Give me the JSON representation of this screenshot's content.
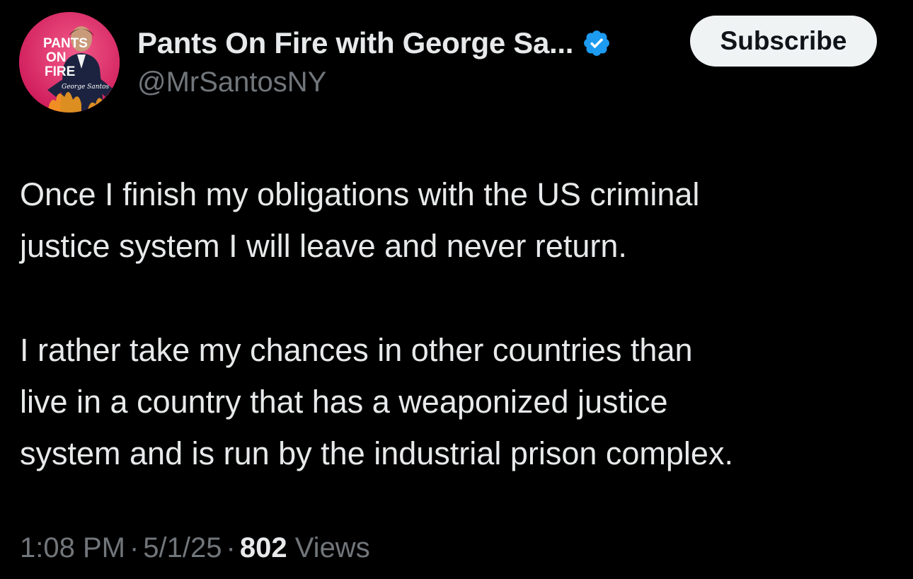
{
  "author": {
    "display_name": "Pants On Fire with George Sa...",
    "handle": "@MrSantosNY",
    "verified_icon": "verified-badge-icon",
    "avatar": {
      "line1": "PANTS",
      "line2": "ON",
      "line3": "FIRE",
      "signature": "George Santos"
    }
  },
  "actions": {
    "subscribe_label": "Subscribe"
  },
  "tweet": {
    "paragraph1_line1": "Once I finish my obligations with the US criminal",
    "paragraph1_line2": "justice system I will leave and never return.",
    "paragraph2_line1": "I rather take my chances in other countries than",
    "paragraph2_line2": "live in a country that has a weaponized justice",
    "paragraph2_line3": "system and is run by the industrial prison complex."
  },
  "meta": {
    "time": "1:08 PM",
    "separator": "·",
    "date": "5/1/25",
    "views_count": "802",
    "views_label": "Views"
  },
  "colors": {
    "background": "#000000",
    "text_primary": "#e7e9ea",
    "text_secondary": "#71767b",
    "verified_blue": "#1d9bf0",
    "subscribe_bg": "#eff3f4",
    "avatar_pink": "#e0306a"
  }
}
